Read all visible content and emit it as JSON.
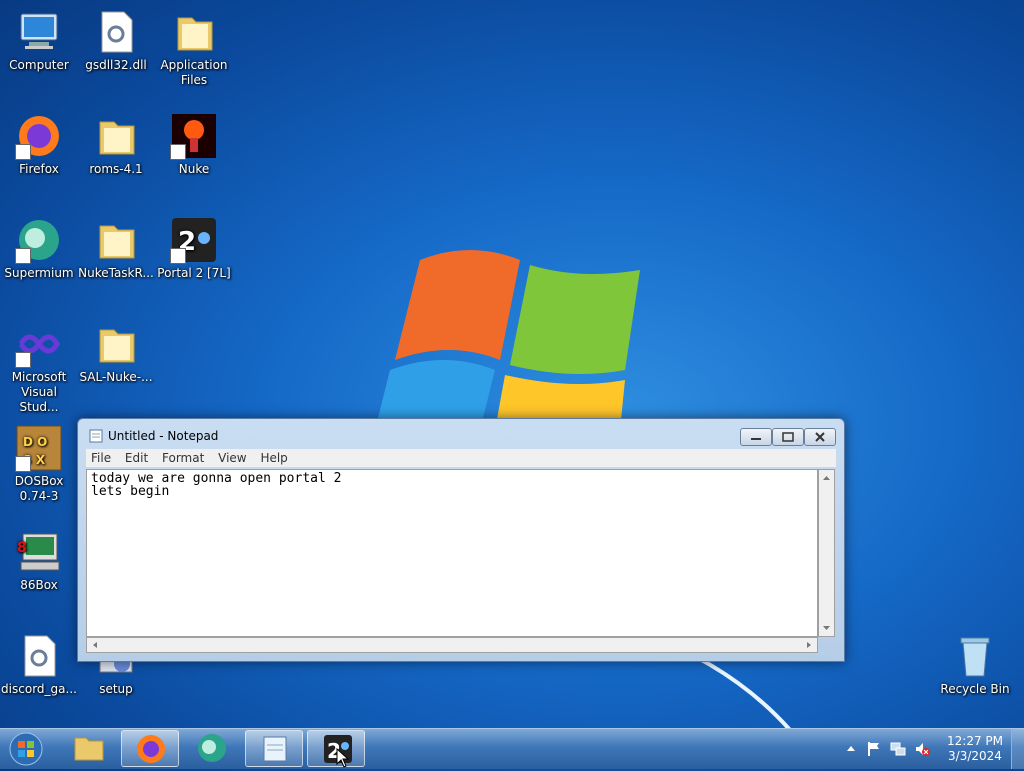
{
  "desktop": {
    "icons": [
      {
        "label": "Computer",
        "icon": "computer-icon"
      },
      {
        "label": "gsdll32.dll",
        "icon": "dll-file-icon"
      },
      {
        "label": "Application Files",
        "icon": "folder-icon"
      },
      {
        "label": "Firefox",
        "icon": "firefox-icon"
      },
      {
        "label": "roms-4.1",
        "icon": "folder-icon"
      },
      {
        "label": "Nuke",
        "icon": "nuke-icon"
      },
      {
        "label": "Supermium",
        "icon": "supermium-icon"
      },
      {
        "label": "NukeTaskR...",
        "icon": "folder-icon"
      },
      {
        "label": "Portal 2 [7L]",
        "icon": "portal2-icon"
      },
      {
        "label": "Microsoft Visual Stud...",
        "icon": "visual-studio-icon"
      },
      {
        "label": "SAL-Nuke-...",
        "icon": "folder-icon"
      },
      {
        "label": "DOSBox 0.74-3",
        "icon": "dosbox-icon"
      },
      {
        "label": "86Box",
        "icon": "86box-icon"
      },
      {
        "label": "discord_ga...",
        "icon": "dll-file-icon"
      },
      {
        "label": "setup",
        "icon": "setup-icon"
      },
      {
        "label": "Recycle Bin",
        "icon": "recycle-bin-icon"
      }
    ]
  },
  "notepad": {
    "title": "Untitled - Notepad",
    "menu": [
      "File",
      "Edit",
      "Format",
      "View",
      "Help"
    ],
    "content": "today we are gonna open portal 2\nlets begin"
  },
  "taskbar": {
    "buttons": [
      {
        "icon": "windows-explorer-icon"
      },
      {
        "icon": "firefox-icon"
      },
      {
        "icon": "supermium-icon"
      },
      {
        "icon": "notepad-icon"
      },
      {
        "icon": "portal2-icon",
        "active": true
      }
    ],
    "clock": {
      "time": "12:27 PM",
      "date": "3/3/2024"
    },
    "tray": [
      "show-hidden-icons-icon",
      "action-center-flag-icon",
      "network-icon",
      "volume-muted-icon"
    ]
  },
  "colors": {
    "desktop": "#1569c7",
    "taskbar": "#3f77b8"
  }
}
